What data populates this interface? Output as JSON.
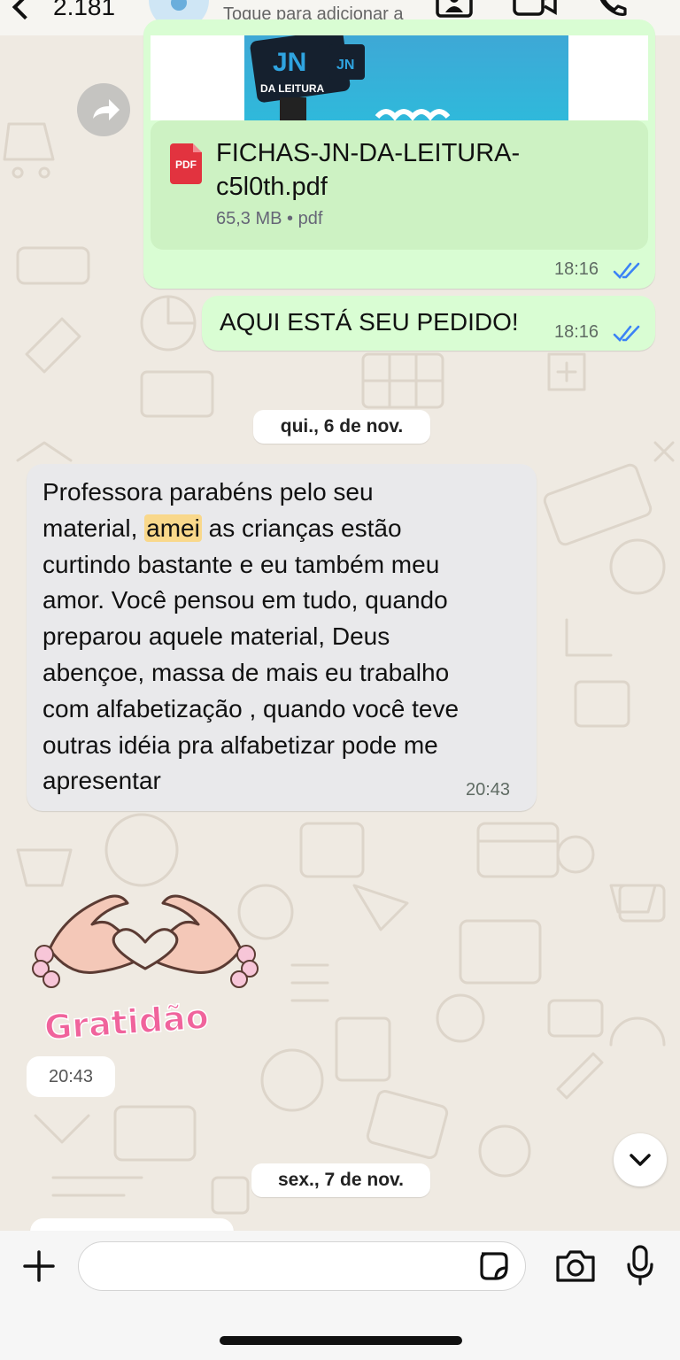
{
  "header": {
    "unread_count": "2.181",
    "contact_subtitle": "Toque para adicionar a",
    "icons": [
      "back-chevron-icon",
      "avatar-placeholder-icon",
      "contact-card-icon",
      "video-camera-icon",
      "phone-icon"
    ]
  },
  "messages": {
    "document": {
      "preview_logo_line1": "JN",
      "preview_logo_line2": "DA LEITURA",
      "preview_logo_side": "JN",
      "file_name": "FICHAS-JN-DA-LEITURA-c5l0th.pdf",
      "file_meta": "65,3 MB • pdf",
      "pdf_label": "PDF",
      "time": "18:16"
    },
    "order_reply": {
      "text": "AQUI ESTÁ SEU PEDIDO!",
      "time": "18:16"
    },
    "date_divider_1": "qui., 6 de nov.",
    "incoming": {
      "line1": "Professora parabéns pelo seu",
      "line2_pre": "material, ",
      "line2_highlight": "amei",
      "line2_post": " as crianças estão",
      "line3": "curtindo bastante e eu também meu",
      "line4": "amor. Você pensou em tudo, quando",
      "line5": "preparou aquele material, Deus",
      "line6": "abençoe, massa de mais eu trabalho",
      "line7": "com alfabetização , quando você teve",
      "line8": "outras idéia pra alfabetizar pode me",
      "line9": "apresentar",
      "time": "20:43"
    },
    "sticker": {
      "caption": "Gratidão",
      "time": "20:43"
    },
    "date_divider_2": "sex., 7 de nov."
  },
  "composer": {
    "input_value": "",
    "icons": [
      "plus-icon",
      "sticker-icon",
      "camera-icon",
      "microphone-icon"
    ]
  },
  "colors": {
    "outgoing_bubble": "#d9fdd3",
    "incoming_bubble": "#e9e9eb",
    "read_ticks": "#3b82f6",
    "wallpaper": "#efeae2",
    "sticker_pink": "#f0639c"
  }
}
